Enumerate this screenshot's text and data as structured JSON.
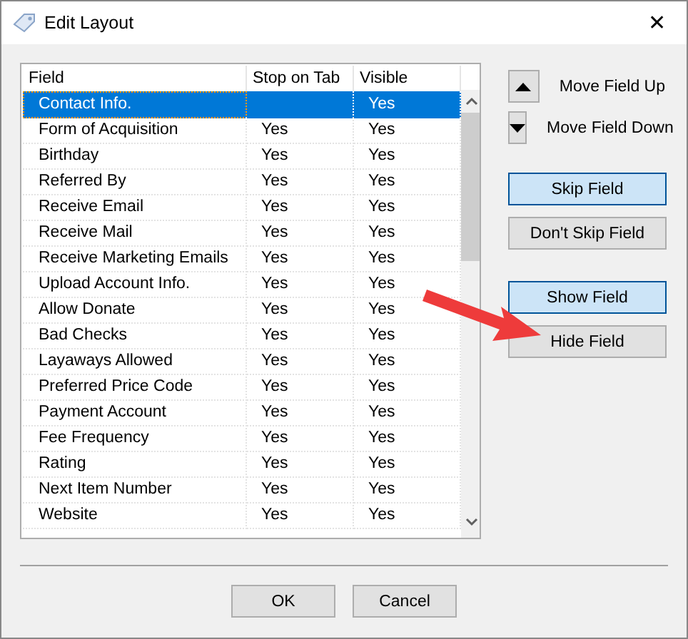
{
  "window": {
    "title": "Edit Layout",
    "close": "✕"
  },
  "table": {
    "columns": [
      "Field",
      "Stop on Tab",
      "Visible"
    ],
    "rows": [
      {
        "field": "Contact Info.",
        "visible": "Yes",
        "selected": true
      },
      {
        "field": "Form of Acquisition",
        "stop_on_tab": "Yes",
        "visible": "Yes",
        "selected": false
      },
      {
        "field": "Birthday",
        "stop_on_tab": "Yes",
        "visible": "Yes",
        "selected": false
      },
      {
        "field": "Referred By",
        "stop_on_tab": "Yes",
        "visible": "Yes",
        "selected": false
      },
      {
        "field": "Receive Email",
        "stop_on_tab": "Yes",
        "visible": "Yes",
        "selected": false
      },
      {
        "field": "Receive Mail",
        "stop_on_tab": "Yes",
        "visible": "Yes",
        "selected": false
      },
      {
        "field": "Receive Marketing Emails",
        "stop_on_tab": "Yes",
        "visible": "Yes",
        "selected": false
      },
      {
        "field": "Upload Account Info.",
        "stop_on_tab": "Yes",
        "visible": "Yes",
        "selected": false
      },
      {
        "field": "Allow Donate",
        "stop_on_tab": "Yes",
        "visible": "Yes",
        "selected": false
      },
      {
        "field": "Bad Checks",
        "stop_on_tab": "Yes",
        "visible": "Yes",
        "selected": false
      },
      {
        "field": "Layaways Allowed",
        "stop_on_tab": "Yes",
        "visible": "Yes",
        "selected": false
      },
      {
        "field": "Preferred Price Code",
        "stop_on_tab": "Yes",
        "visible": "Yes",
        "selected": false
      },
      {
        "field": "Payment Account",
        "stop_on_tab": "Yes",
        "visible": "Yes",
        "selected": false
      },
      {
        "field": "Fee Frequency",
        "stop_on_tab": "Yes",
        "visible": "Yes",
        "selected": false
      },
      {
        "field": "Rating",
        "stop_on_tab": "Yes",
        "visible": "Yes",
        "selected": false
      },
      {
        "field": "Next Item Number",
        "stop_on_tab": "Yes",
        "visible": "Yes",
        "selected": false
      },
      {
        "field": "Website",
        "stop_on_tab": "Yes",
        "visible": "Yes",
        "selected": false
      }
    ]
  },
  "move_buttons": [
    {
      "kind": "up",
      "label": "Move Field Up"
    },
    {
      "kind": "down",
      "label": "Move Field Down"
    }
  ],
  "button_groups": [
    [
      {
        "label": "Skip Field",
        "highlighted": true
      },
      {
        "label": "Don't Skip Field",
        "highlighted": false
      }
    ],
    [
      {
        "label": "Show Field",
        "highlighted": true
      },
      {
        "label": "Hide Field",
        "highlighted": false
      }
    ]
  ],
  "footer_buttons": [
    "OK",
    "Cancel"
  ]
}
